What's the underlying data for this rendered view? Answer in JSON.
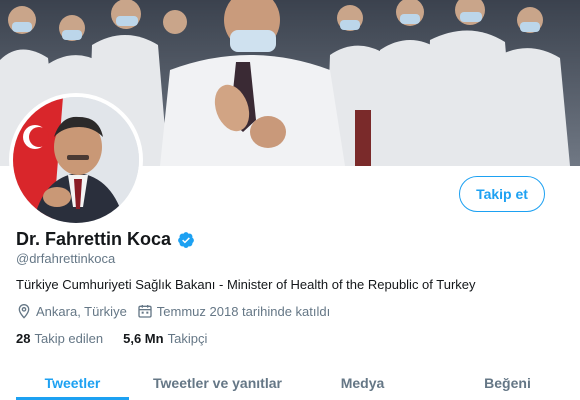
{
  "header": {
    "banner_alt": "healthcare workers applauding",
    "follow_label": "Takip et"
  },
  "profile": {
    "display_name": "Dr. Fahrettin Koca",
    "verified": true,
    "handle": "@drfahrettinkoca",
    "bio": "Türkiye Cumhuriyeti Sağlık Bakanı - Minister of Health of the Republic of Turkey",
    "location": "Ankara, Türkiye",
    "joined": "Temmuz 2018 tarihinde katıldı",
    "location_icon": "location-pin-icon",
    "joined_icon": "calendar-icon"
  },
  "counts": {
    "following_value": "28",
    "following_label": "Takip edilen",
    "followers_value": "5,6 Mn",
    "followers_label": "Takipçi"
  },
  "tabs": [
    {
      "label": "Tweetler",
      "active": true
    },
    {
      "label": "Tweetler ve yanıtlar",
      "active": false
    },
    {
      "label": "Medya",
      "active": false
    },
    {
      "label": "Beğeni",
      "active": false
    }
  ],
  "colors": {
    "accent": "#1da1f2",
    "secondary_text": "#657786",
    "primary_text": "#14171a"
  }
}
